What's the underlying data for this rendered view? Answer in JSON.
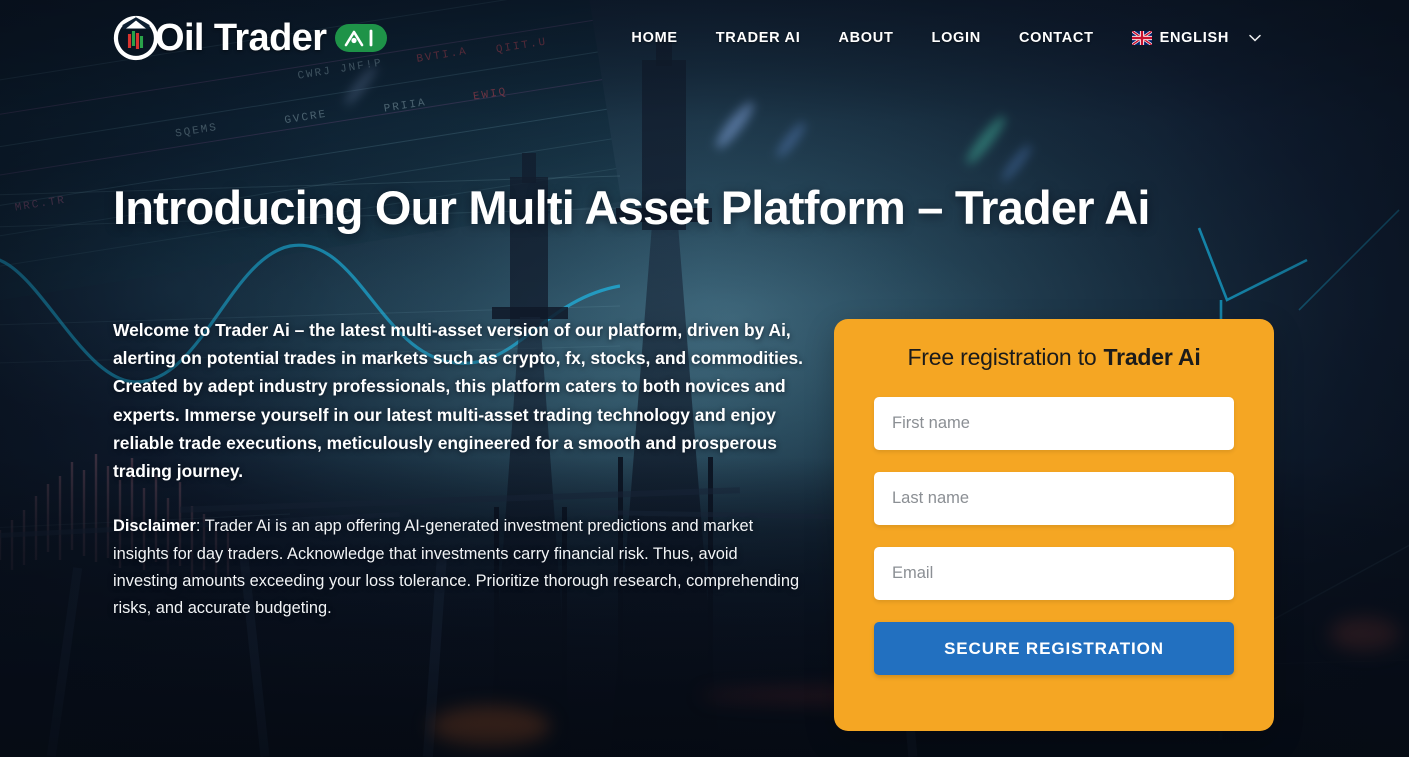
{
  "brand": {
    "name": "Oil Trader",
    "badge_label": "AI",
    "logo_icon": "oil-trader-circle-candlestick-logo",
    "badge_color": "#1e9348"
  },
  "nav": {
    "items": [
      {
        "label": "HOME",
        "name": "home"
      },
      {
        "label": "TRADER AI",
        "name": "trader-ai"
      },
      {
        "label": "ABOUT",
        "name": "about"
      },
      {
        "label": "LOGIN",
        "name": "login"
      },
      {
        "label": "CONTACT",
        "name": "contact"
      }
    ],
    "language": {
      "label": "ENGLISH",
      "flag_icon": "uk-flag-icon",
      "chevron_icon": "chevron-down-icon"
    }
  },
  "hero": {
    "title": "Introducing Our Multi Asset Platform – Trader Ai",
    "lead": "Welcome to Trader Ai – the latest multi-asset version of our platform, driven by Ai, alerting on potential trades in markets such as crypto, fx, stocks, and commodities. Created by adept industry professionals, this platform caters to both novices and experts. Immerse yourself in our latest multi-asset trading technology and enjoy reliable trade executions, meticulously engineered for a smooth and prosperous trading journey.",
    "disclaimer_label": "Disclaimer",
    "disclaimer_text": ": Trader Ai is an app offering AI-generated investment predictions and market insights for day traders. Acknowledge that investments carry financial risk. Thus, avoid investing amounts exceeding your loss tolerance. Prioritize thorough research, comprehending risks, and accurate budgeting."
  },
  "registration": {
    "title_prefix": "Free registration to",
    "title_brand": "Trader Ai",
    "card_color": "#f5a623",
    "fields": [
      {
        "name": "first-name",
        "placeholder": "First name",
        "value": ""
      },
      {
        "name": "last-name",
        "placeholder": "Last name",
        "value": ""
      },
      {
        "name": "email",
        "placeholder": "Email",
        "value": ""
      }
    ],
    "submit_label": "SECURE REGISTRATION",
    "submit_color": "#2270c0"
  },
  "background": {
    "scene": "offshore-oil-rig-at-dusk-with-trading-chart-overlay",
    "accent_line_color": "#1bb8e8"
  }
}
